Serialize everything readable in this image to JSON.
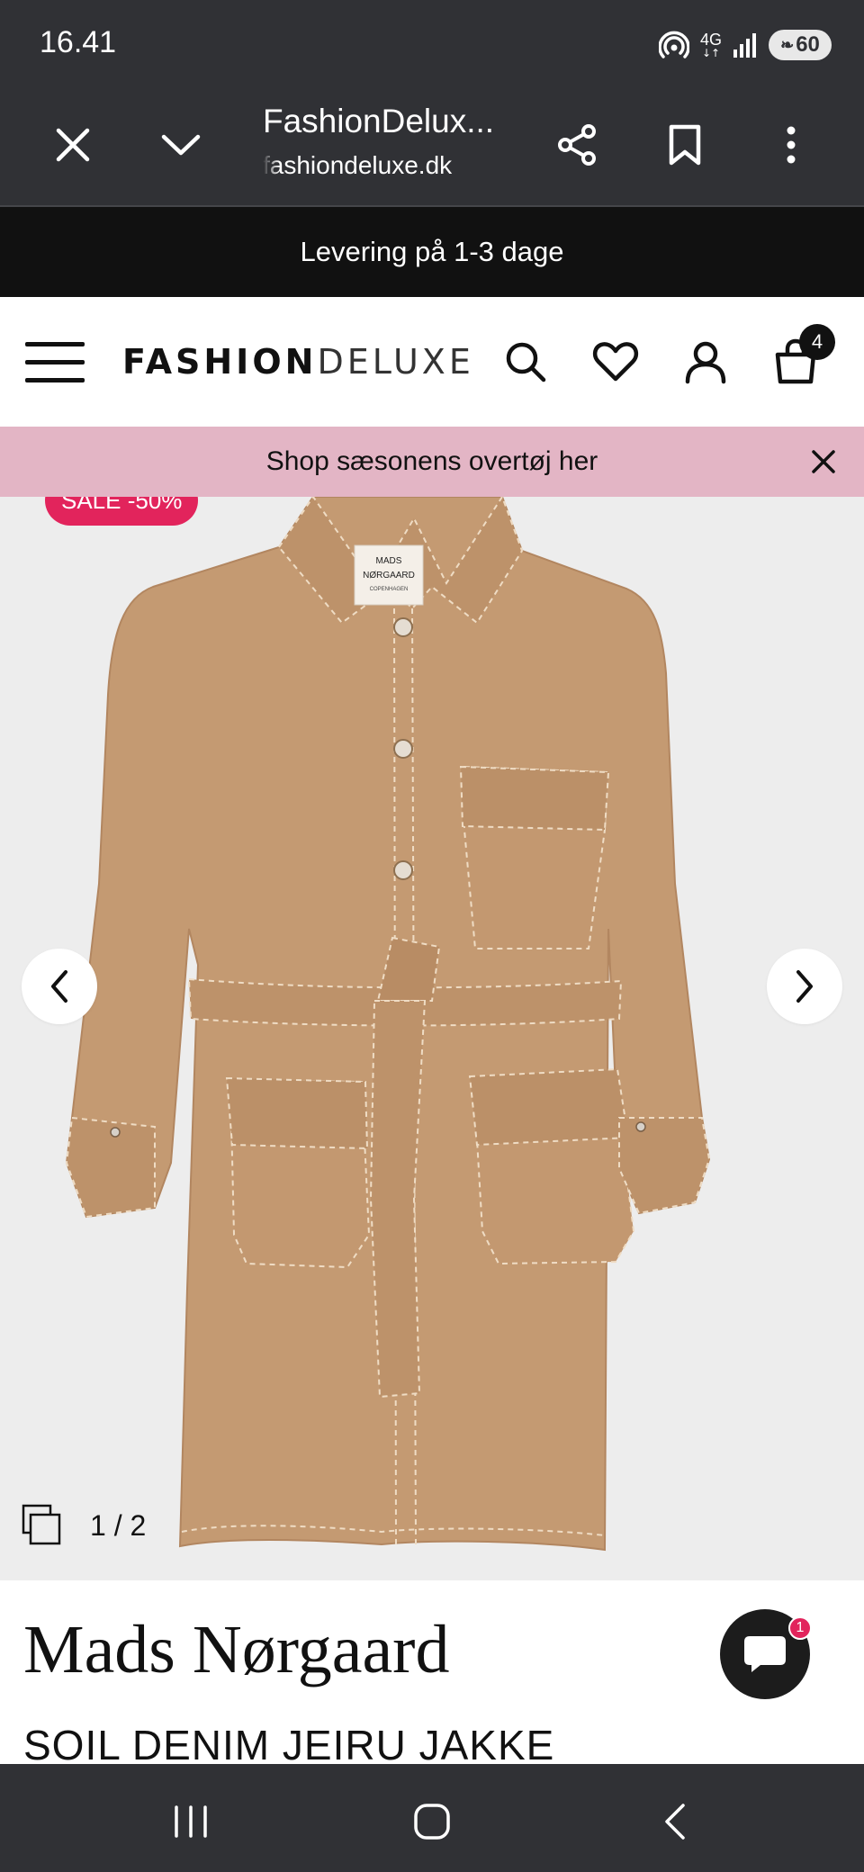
{
  "status_bar": {
    "time": "16.41",
    "network": "4G",
    "battery": "60"
  },
  "browser": {
    "title": "FashionDelux...",
    "url": "fashiondeluxe.dk"
  },
  "delivery_banner": "Levering på 1-3 dage",
  "header": {
    "logo_bold": "FASHION",
    "logo_light": "DELUXE",
    "cart_count": "4"
  },
  "promo": {
    "text": "Shop sæsonens overtøj her"
  },
  "gallery": {
    "sale_badge": "SALE -50%",
    "counter": "1 / 2",
    "product_color": "#c49a72",
    "stitch_color": "#efdcc4"
  },
  "product": {
    "brand": "Mads Nørgaard",
    "name": "SOIL DENIM JEIRU JAKKE",
    "coat_label_line1": "MADS",
    "coat_label_line2": "NØRGAARD",
    "coat_label_line3": "COPENHAGEN"
  },
  "chat": {
    "badge": "1"
  },
  "colors": {
    "dark_bar": "#303135",
    "promo_pink": "#e3b5c5",
    "sale_red": "#e2245c",
    "gallery_bg": "#ededed"
  }
}
